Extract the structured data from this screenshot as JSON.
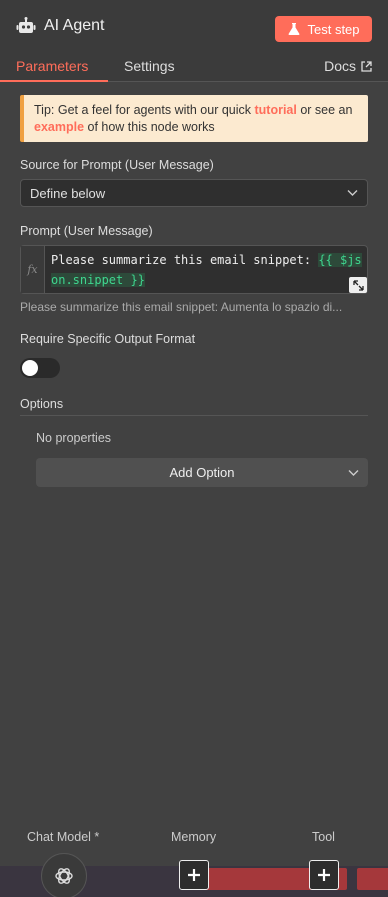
{
  "header": {
    "title": "AI Agent",
    "test_step_label": "Test step"
  },
  "tabs": [
    {
      "label": "Parameters",
      "active": true
    },
    {
      "label": "Settings",
      "active": false
    }
  ],
  "docs_label": "Docs",
  "tip": {
    "prefix": "Tip: Get a feel for agents with our quick ",
    "link1": "tutorial",
    "middle": " or see an ",
    "link2": "example",
    "suffix": " of how this node works"
  },
  "source_prompt": {
    "label": "Source for Prompt (User Message)",
    "value": "Define below"
  },
  "prompt": {
    "label": "Prompt (User Message)",
    "fx_label": "fx",
    "text": "Please summarize this email snippet:  ",
    "expression": "{{ $json.snippet }}",
    "preview": "Please summarize this email snippet:  Aumenta lo spazio di..."
  },
  "output_format": {
    "label": "Require Specific Output Format",
    "enabled": false
  },
  "options": {
    "title": "Options",
    "empty_text": "No properties",
    "add_label": "Add Option"
  },
  "connections": {
    "chat_model": "Chat Model *",
    "memory": "Memory",
    "tool": "Tool"
  },
  "colors": {
    "accent": "#ff6d5a",
    "panel_bg": "#414141",
    "expression_green": "#3fd68f"
  }
}
